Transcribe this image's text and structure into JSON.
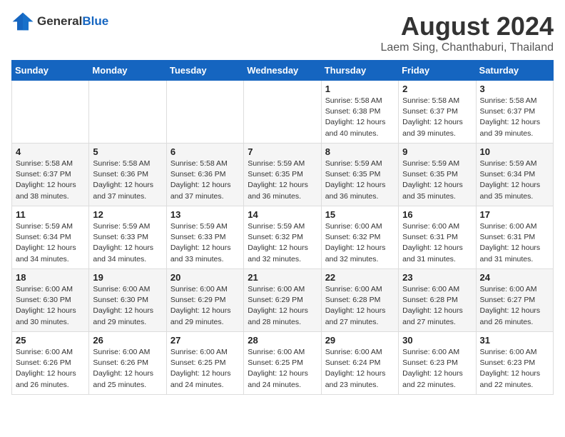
{
  "logo": {
    "general": "General",
    "blue": "Blue"
  },
  "title": "August 2024",
  "subtitle": "Laem Sing, Chanthaburi, Thailand",
  "days_of_week": [
    "Sunday",
    "Monday",
    "Tuesday",
    "Wednesday",
    "Thursday",
    "Friday",
    "Saturday"
  ],
  "weeks": [
    [
      {
        "day": "",
        "content": ""
      },
      {
        "day": "",
        "content": ""
      },
      {
        "day": "",
        "content": ""
      },
      {
        "day": "",
        "content": ""
      },
      {
        "day": "1",
        "content": "Sunrise: 5:58 AM\nSunset: 6:38 PM\nDaylight: 12 hours\nand 40 minutes."
      },
      {
        "day": "2",
        "content": "Sunrise: 5:58 AM\nSunset: 6:37 PM\nDaylight: 12 hours\nand 39 minutes."
      },
      {
        "day": "3",
        "content": "Sunrise: 5:58 AM\nSunset: 6:37 PM\nDaylight: 12 hours\nand 39 minutes."
      }
    ],
    [
      {
        "day": "4",
        "content": "Sunrise: 5:58 AM\nSunset: 6:37 PM\nDaylight: 12 hours\nand 38 minutes."
      },
      {
        "day": "5",
        "content": "Sunrise: 5:58 AM\nSunset: 6:36 PM\nDaylight: 12 hours\nand 37 minutes."
      },
      {
        "day": "6",
        "content": "Sunrise: 5:58 AM\nSunset: 6:36 PM\nDaylight: 12 hours\nand 37 minutes."
      },
      {
        "day": "7",
        "content": "Sunrise: 5:59 AM\nSunset: 6:35 PM\nDaylight: 12 hours\nand 36 minutes."
      },
      {
        "day": "8",
        "content": "Sunrise: 5:59 AM\nSunset: 6:35 PM\nDaylight: 12 hours\nand 36 minutes."
      },
      {
        "day": "9",
        "content": "Sunrise: 5:59 AM\nSunset: 6:35 PM\nDaylight: 12 hours\nand 35 minutes."
      },
      {
        "day": "10",
        "content": "Sunrise: 5:59 AM\nSunset: 6:34 PM\nDaylight: 12 hours\nand 35 minutes."
      }
    ],
    [
      {
        "day": "11",
        "content": "Sunrise: 5:59 AM\nSunset: 6:34 PM\nDaylight: 12 hours\nand 34 minutes."
      },
      {
        "day": "12",
        "content": "Sunrise: 5:59 AM\nSunset: 6:33 PM\nDaylight: 12 hours\nand 34 minutes."
      },
      {
        "day": "13",
        "content": "Sunrise: 5:59 AM\nSunset: 6:33 PM\nDaylight: 12 hours\nand 33 minutes."
      },
      {
        "day": "14",
        "content": "Sunrise: 5:59 AM\nSunset: 6:32 PM\nDaylight: 12 hours\nand 32 minutes."
      },
      {
        "day": "15",
        "content": "Sunrise: 6:00 AM\nSunset: 6:32 PM\nDaylight: 12 hours\nand 32 minutes."
      },
      {
        "day": "16",
        "content": "Sunrise: 6:00 AM\nSunset: 6:31 PM\nDaylight: 12 hours\nand 31 minutes."
      },
      {
        "day": "17",
        "content": "Sunrise: 6:00 AM\nSunset: 6:31 PM\nDaylight: 12 hours\nand 31 minutes."
      }
    ],
    [
      {
        "day": "18",
        "content": "Sunrise: 6:00 AM\nSunset: 6:30 PM\nDaylight: 12 hours\nand 30 minutes."
      },
      {
        "day": "19",
        "content": "Sunrise: 6:00 AM\nSunset: 6:30 PM\nDaylight: 12 hours\nand 29 minutes."
      },
      {
        "day": "20",
        "content": "Sunrise: 6:00 AM\nSunset: 6:29 PM\nDaylight: 12 hours\nand 29 minutes."
      },
      {
        "day": "21",
        "content": "Sunrise: 6:00 AM\nSunset: 6:29 PM\nDaylight: 12 hours\nand 28 minutes."
      },
      {
        "day": "22",
        "content": "Sunrise: 6:00 AM\nSunset: 6:28 PM\nDaylight: 12 hours\nand 27 minutes."
      },
      {
        "day": "23",
        "content": "Sunrise: 6:00 AM\nSunset: 6:28 PM\nDaylight: 12 hours\nand 27 minutes."
      },
      {
        "day": "24",
        "content": "Sunrise: 6:00 AM\nSunset: 6:27 PM\nDaylight: 12 hours\nand 26 minutes."
      }
    ],
    [
      {
        "day": "25",
        "content": "Sunrise: 6:00 AM\nSunset: 6:26 PM\nDaylight: 12 hours\nand 26 minutes."
      },
      {
        "day": "26",
        "content": "Sunrise: 6:00 AM\nSunset: 6:26 PM\nDaylight: 12 hours\nand 25 minutes."
      },
      {
        "day": "27",
        "content": "Sunrise: 6:00 AM\nSunset: 6:25 PM\nDaylight: 12 hours\nand 24 minutes."
      },
      {
        "day": "28",
        "content": "Sunrise: 6:00 AM\nSunset: 6:25 PM\nDaylight: 12 hours\nand 24 minutes."
      },
      {
        "day": "29",
        "content": "Sunrise: 6:00 AM\nSunset: 6:24 PM\nDaylight: 12 hours\nand 23 minutes."
      },
      {
        "day": "30",
        "content": "Sunrise: 6:00 AM\nSunset: 6:23 PM\nDaylight: 12 hours\nand 22 minutes."
      },
      {
        "day": "31",
        "content": "Sunrise: 6:00 AM\nSunset: 6:23 PM\nDaylight: 12 hours\nand 22 minutes."
      }
    ]
  ]
}
